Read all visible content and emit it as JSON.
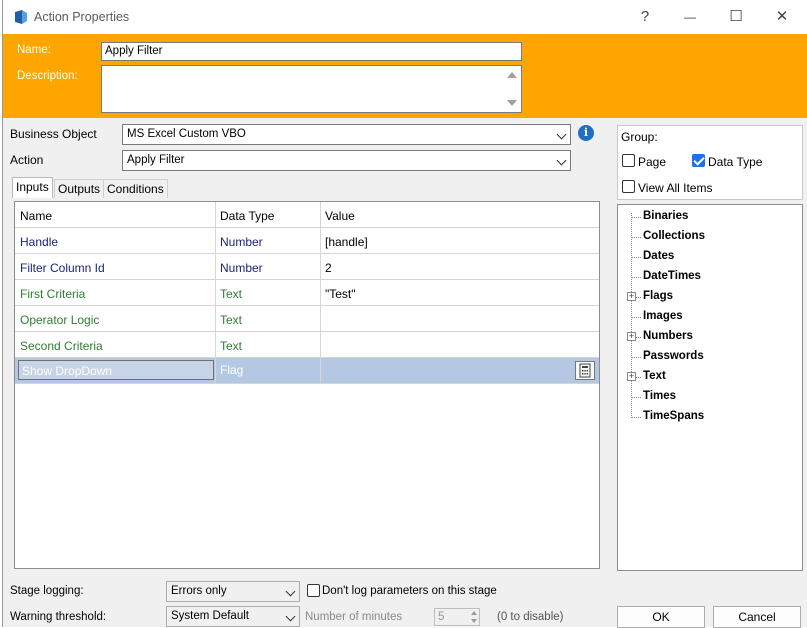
{
  "window": {
    "title": "Action Properties",
    "help_glyph": "?",
    "minimize_glyph": "—",
    "maximize_glyph": "☐",
    "close_glyph": "✕"
  },
  "header": {
    "name_label": "Name:",
    "name_value": "Apply Filter",
    "description_label": "Description:",
    "description_value": ""
  },
  "form": {
    "business_object_label": "Business Object",
    "business_object_value": "MS Excel Custom VBO",
    "action_label": "Action",
    "action_value": "Apply Filter"
  },
  "tabs": [
    "Inputs",
    "Outputs",
    "Conditions"
  ],
  "grid": {
    "columns": [
      "Name",
      "Data Type",
      "Value"
    ],
    "rows": [
      {
        "name": "Handle",
        "type": "Number",
        "value": "[handle]"
      },
      {
        "name": "Filter Column Id",
        "type": "Number",
        "value": "2"
      },
      {
        "name": "First Criteria",
        "type": "Text",
        "value": "\"Test\""
      },
      {
        "name": "Operator Logic",
        "type": "Text",
        "value": ""
      },
      {
        "name": "Second Criteria",
        "type": "Text",
        "value": ""
      },
      {
        "name": "Show DropDown",
        "type": "Flag",
        "value": ""
      }
    ]
  },
  "group": {
    "label": "Group:",
    "page_label": "Page",
    "page_checked": false,
    "data_type_label": "Data Type",
    "data_type_checked": true,
    "view_all_label": "View All Items",
    "view_all_checked": false
  },
  "tree": {
    "items": [
      {
        "label": "Binaries",
        "expandable": false
      },
      {
        "label": "Collections",
        "expandable": false
      },
      {
        "label": "Dates",
        "expandable": false
      },
      {
        "label": "DateTimes",
        "expandable": false
      },
      {
        "label": "Flags",
        "expandable": true
      },
      {
        "label": "Images",
        "expandable": false
      },
      {
        "label": "Numbers",
        "expandable": true
      },
      {
        "label": "Passwords",
        "expandable": false
      },
      {
        "label": "Text",
        "expandable": true
      },
      {
        "label": "Times",
        "expandable": false
      },
      {
        "label": "TimeSpans",
        "expandable": false
      }
    ]
  },
  "bottom": {
    "stage_logging_label": "Stage logging:",
    "stage_logging_value": "Errors only",
    "dont_log_label": "Don't log parameters on this stage",
    "warning_label": "Warning threshold:",
    "warning_value": "System Default",
    "minutes_label": "Number of minutes",
    "minutes_value": "5",
    "zero_disable": "(0 to disable)",
    "ok_label": "OK",
    "cancel_label": "Cancel"
  },
  "colors": {
    "header_orange": "#ffa500",
    "number_type": "#1a237e",
    "text_type": "#2e7d32",
    "selected_row": "#b5c8e3"
  }
}
